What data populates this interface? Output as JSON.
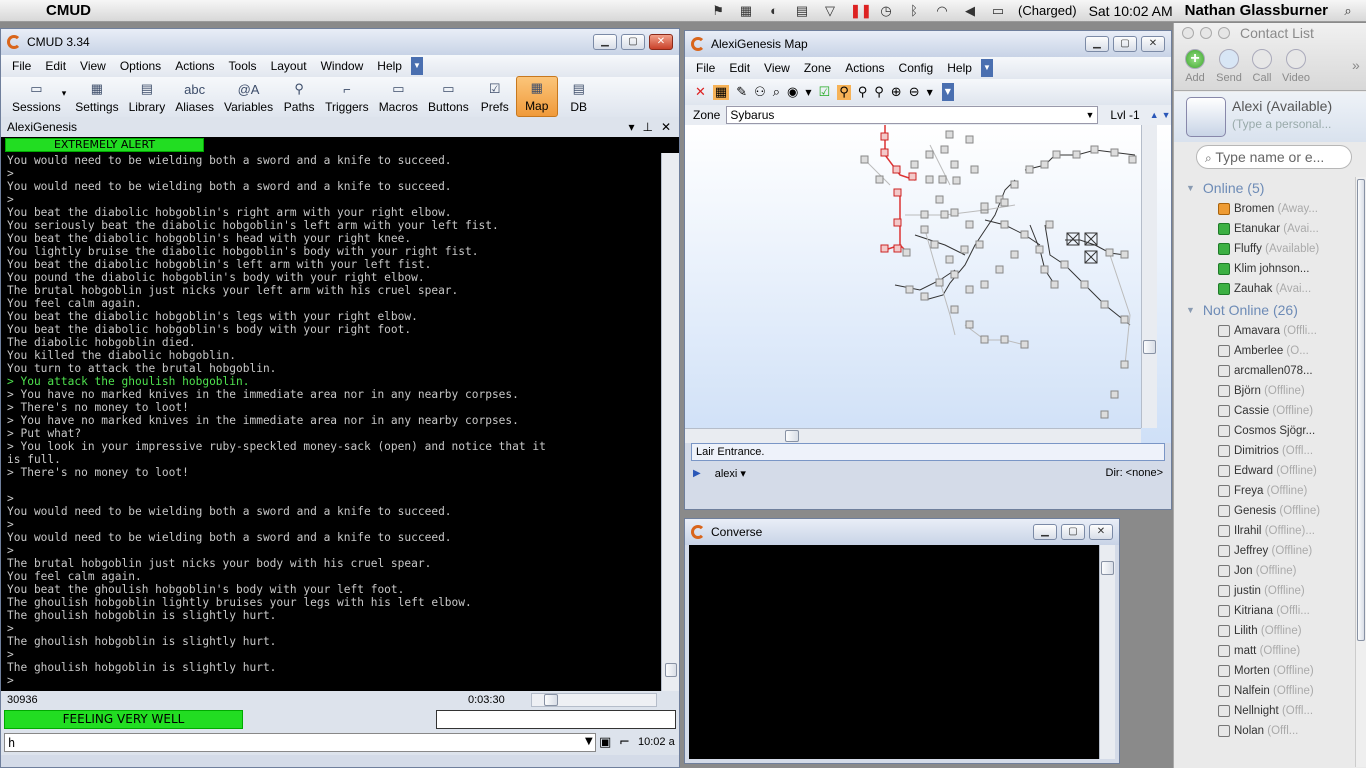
{
  "macbar": {
    "app_name": "CMUD",
    "battery": "(Charged)",
    "clock": "Sat 10:02 AM",
    "user": "Nathan Glassburner"
  },
  "cmud": {
    "title": "CMUD 3.34",
    "menu": [
      "File",
      "Edit",
      "View",
      "Options",
      "Actions",
      "Tools",
      "Layout",
      "Window",
      "Help"
    ],
    "toolbar": [
      {
        "label": "Sessions",
        "icon": "folder-icon"
      },
      {
        "label": "Settings",
        "icon": "settings-icon"
      },
      {
        "label": "Library",
        "icon": "library-icon"
      },
      {
        "label": "Aliases",
        "icon": "aliases-icon"
      },
      {
        "label": "Variables",
        "icon": "variables-icon"
      },
      {
        "label": "Paths",
        "icon": "paths-icon"
      },
      {
        "label": "Triggers",
        "icon": "triggers-icon"
      },
      {
        "label": "Macros",
        "icon": "macros-icon"
      },
      {
        "label": "Buttons",
        "icon": "buttons-icon"
      },
      {
        "label": "Prefs",
        "icon": "prefs-icon"
      },
      {
        "label": "Map",
        "icon": "map-icon",
        "active": true
      },
      {
        "label": "DB",
        "icon": "db-icon"
      }
    ],
    "session_name": "AlexiGenesis",
    "alert_bar": "EXTREMELY ALERT",
    "lines": [
      {
        "t": "You would need to be wielding both a sword and a knife to succeed."
      },
      {
        "t": ">"
      },
      {
        "t": "You would need to be wielding both a sword and a knife to succeed."
      },
      {
        "t": ">"
      },
      {
        "t": "You beat the diabolic hobgoblin's right arm with your right elbow."
      },
      {
        "t": "You seriously beat the diabolic hobgoblin's left arm with your left fist."
      },
      {
        "t": "You beat the diabolic hobgoblin's head with your right knee."
      },
      {
        "t": "You lightly bruise the diabolic hobgoblin's body with your right fist."
      },
      {
        "t": "You beat the diabolic hobgoblin's left arm with your left fist."
      },
      {
        "t": "You pound the diabolic hobgoblin's body with your right elbow."
      },
      {
        "t": "The brutal hobgoblin just nicks your left arm with his cruel spear."
      },
      {
        "t": "You feel calm again."
      },
      {
        "t": "You beat the diabolic hobgoblin's legs with your right elbow."
      },
      {
        "t": "You beat the diabolic hobgoblin's body with your right foot."
      },
      {
        "t": "The diabolic hobgoblin died."
      },
      {
        "t": "You killed the diabolic hobgoblin."
      },
      {
        "t": "You turn to attack the brutal hobgoblin."
      },
      {
        "t": "> You attack the ghoulish hobgoblin.",
        "green": true
      },
      {
        "t": "> You have no marked knives in the immediate area nor in any nearby corpses."
      },
      {
        "t": "> There's no money to loot!"
      },
      {
        "t": "> You have no marked knives in the immediate area nor in any nearby corpses."
      },
      {
        "t": "> Put what?"
      },
      {
        "t": "> You look in your impressive ruby-speckled money-sack (open) and notice that it"
      },
      {
        "t": "is full."
      },
      {
        "t": "> There's no money to loot!"
      },
      {
        "t": ""
      },
      {
        "t": ">"
      },
      {
        "t": "You would need to be wielding both a sword and a knife to succeed."
      },
      {
        "t": ">"
      },
      {
        "t": "You would need to be wielding both a sword and a knife to succeed."
      },
      {
        "t": ">"
      },
      {
        "t": "The brutal hobgoblin just nicks your body with his cruel spear."
      },
      {
        "t": "You feel calm again."
      },
      {
        "t": "You beat the ghoulish hobgoblin's body with your left foot."
      },
      {
        "t": "The ghoulish hobgoblin lightly bruises your legs with his left elbow."
      },
      {
        "t": "The ghoulish hobgoblin is slightly hurt."
      },
      {
        "t": ">"
      },
      {
        "t": "The ghoulish hobgoblin is slightly hurt."
      },
      {
        "t": ">"
      },
      {
        "t": "The ghoulish hobgoblin is slightly hurt."
      },
      {
        "t": ">"
      }
    ],
    "status_number": "30936",
    "status_timer": "0:03:30",
    "health_bar": "FEELING VERY WELL",
    "command_input": "h",
    "clock": "10:02 a",
    "colors": {
      "green_bar": "#22dd22",
      "terminal_bg": "#000000",
      "echo_green": "#4ee04e"
    }
  },
  "map": {
    "title": "AlexiGenesis Map",
    "menu": [
      "File",
      "Edit",
      "View",
      "Zone",
      "Actions",
      "Config",
      "Help"
    ],
    "zone_label": "Zone",
    "zone_value": "Sybarus",
    "level": "Lvl -1",
    "room_name": "Lair Entrance.",
    "character": "alexi",
    "direction": "Dir: <none>"
  },
  "converse": {
    "title": "Converse"
  },
  "contacts": {
    "title": "Contact List",
    "buttons": [
      "Add",
      "Send",
      "Call",
      "Video"
    ],
    "self_name": "Alexi (Available)",
    "self_message": "(Type a personal...",
    "search_placeholder": "Type name or e...",
    "groups": [
      {
        "header": "Online (5)",
        "items": [
          {
            "name": "Bromen",
            "status": "(Away...",
            "state": "away"
          },
          {
            "name": "Etanukar",
            "status": "(Avai...",
            "state": "online"
          },
          {
            "name": "Fluffy",
            "status": "(Available)",
            "state": "online"
          },
          {
            "name": "Klim johnson...",
            "status": "",
            "state": "online"
          },
          {
            "name": "Zauhak",
            "status": "(Avai...",
            "state": "online"
          }
        ]
      },
      {
        "header": "Not Online (26)",
        "items": [
          {
            "name": "Amavara",
            "status": "(Offli...",
            "state": "offline"
          },
          {
            "name": "Amberlee",
            "status": "(O...",
            "state": "offline"
          },
          {
            "name": "arcmallen078...",
            "status": "",
            "state": "offline"
          },
          {
            "name": "Björn",
            "status": "(Offline)",
            "state": "offline"
          },
          {
            "name": "Cassie",
            "status": "(Offline)",
            "state": "offline"
          },
          {
            "name": "Cosmos Sjögr...",
            "status": "",
            "state": "offline"
          },
          {
            "name": "Dimitrios",
            "status": "(Offl...",
            "state": "offline"
          },
          {
            "name": "Edward",
            "status": "(Offline)",
            "state": "offline"
          },
          {
            "name": "Freya",
            "status": "(Offline)",
            "state": "offline"
          },
          {
            "name": "Genesis",
            "status": "(Offline)",
            "state": "offline"
          },
          {
            "name": "Ilrahil",
            "status": "(Offline)...",
            "state": "offline"
          },
          {
            "name": "Jeffrey",
            "status": "(Offline)",
            "state": "offline"
          },
          {
            "name": "Jon",
            "status": "(Offline)",
            "state": "offline"
          },
          {
            "name": "justin",
            "status": "(Offline)",
            "state": "offline"
          },
          {
            "name": "Kitriana",
            "status": "(Offli...",
            "state": "offline"
          },
          {
            "name": "Lilith",
            "status": "(Offline)",
            "state": "offline"
          },
          {
            "name": "matt",
            "status": "(Offline)",
            "state": "offline"
          },
          {
            "name": "Morten",
            "status": "(Offline)",
            "state": "offline"
          },
          {
            "name": "Nalfein",
            "status": "(Offline)",
            "state": "offline"
          },
          {
            "name": "Nellnight",
            "status": "(Offl...",
            "state": "offline"
          },
          {
            "name": "Nolan",
            "status": "(Offl...",
            "state": "offline"
          }
        ]
      }
    ]
  }
}
